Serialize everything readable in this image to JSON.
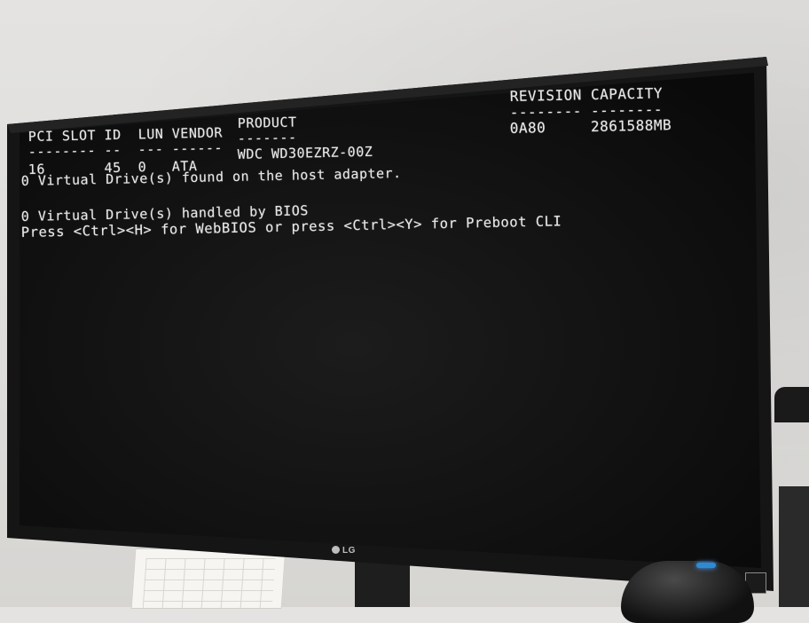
{
  "screen": {
    "header_row": "PCI SLOT ID  LUN VENDOR",
    "header_dash": "-------- --  --- ------",
    "product_header": "PRODUCT",
    "product_dash": "-------",
    "revision_header": "REVISION CAPACITY",
    "revision_dash": "-------- --------",
    "revision_value": "0A80     2861588MB",
    "drive_row": "16       45  0   ATA",
    "product_value": "WDC WD30EZRZ-00Z",
    "line1": "0 Virtual Drive(s) found on the host adapter.",
    "line2": "0 Virtual Drive(s) handled by BIOS",
    "line3": "Press <Ctrl><H> for WebBIOS or press <Ctrl><Y> for Preboot CLI"
  },
  "monitor": {
    "brand": "LG"
  }
}
